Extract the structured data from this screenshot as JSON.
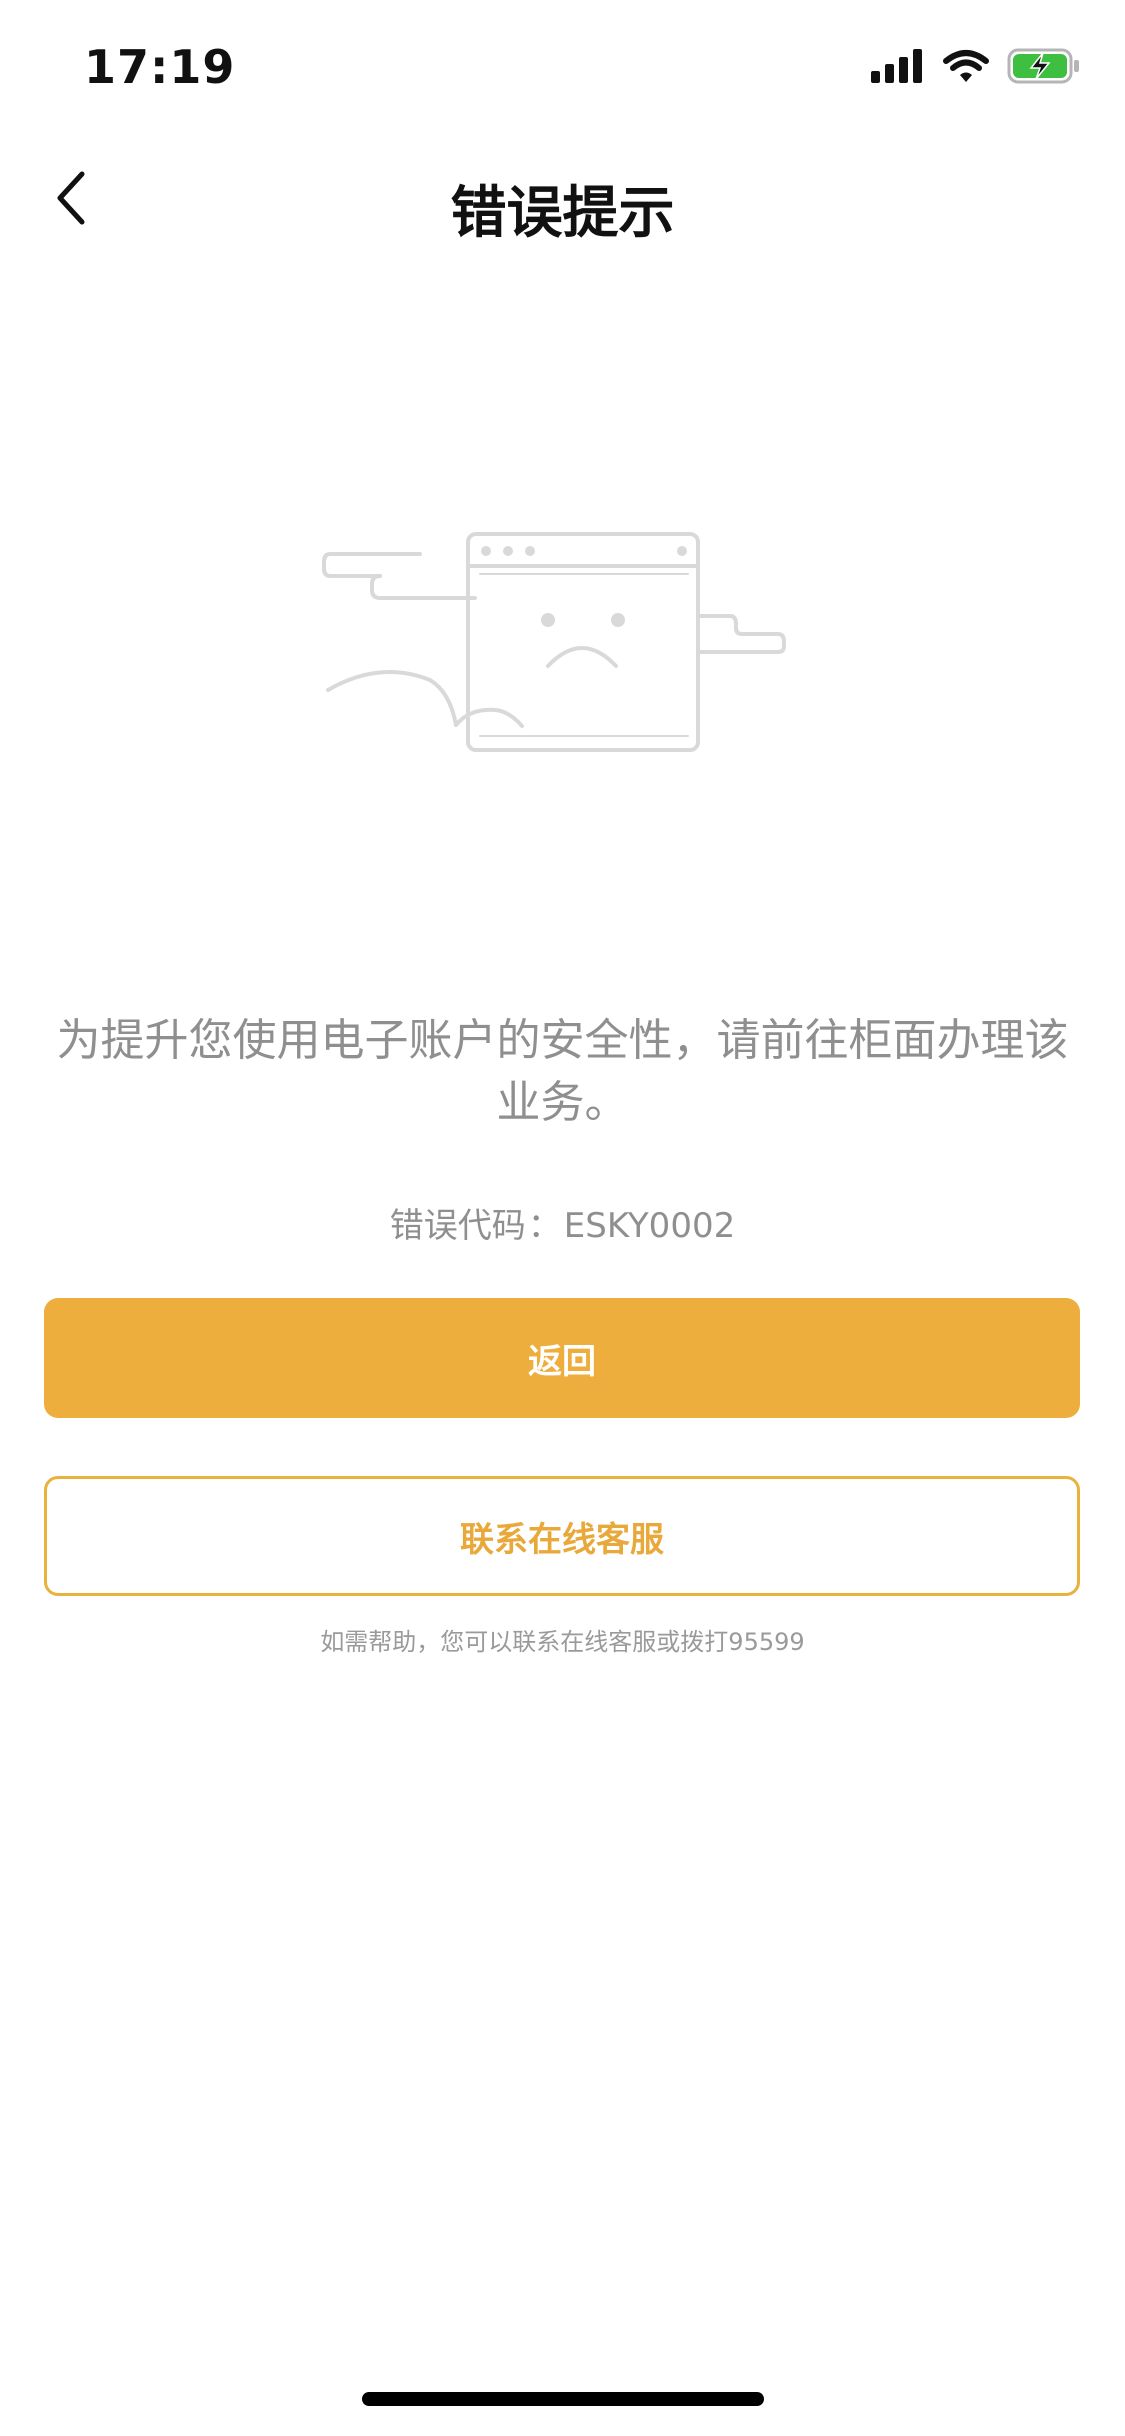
{
  "status_bar": {
    "time": "17:19",
    "icons": [
      "cellular-signal-icon",
      "wifi-icon",
      "battery-charging-icon"
    ],
    "battery_color": "#3fbf3f"
  },
  "nav": {
    "back_icon": "chevron-left-icon",
    "title": "错误提示"
  },
  "illustration": {
    "icon": "browser-sad-face-icon",
    "stroke_color": "#d9d9d9"
  },
  "message": {
    "text": "为提升您使用电子账户的安全性，请前往柜面办理该业务。",
    "error_code_label": "错误代码",
    "error_code_sep": "：",
    "error_code_value": "ESKY0002"
  },
  "buttons": {
    "back_label": "返回",
    "contact_label": "联系在线客服"
  },
  "help": {
    "text": "如需帮助，您可以联系在线客服或拨打95599"
  },
  "colors": {
    "accent": "#eeae3d",
    "accent_border": "#e8b23c",
    "text_muted": "#8f8f8f"
  }
}
